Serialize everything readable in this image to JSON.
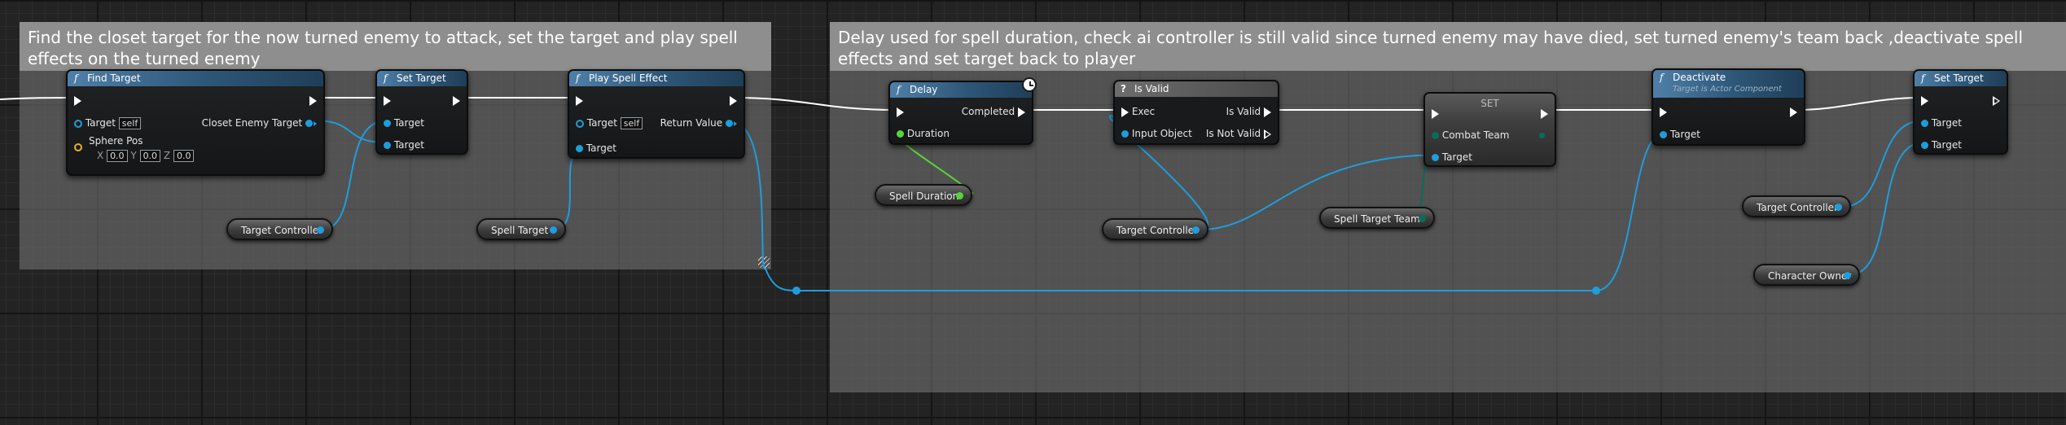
{
  "comments": [
    {
      "title": "Find the closet target for the now turned enemy to attack, set the target and play spell effects on the turned enemy"
    },
    {
      "title": "Delay used for spell duration, check ai controller is still valid since turned enemy may have died, set turned enemy's team back ,deactivate spell effects and set target back to player"
    }
  ],
  "find_target": {
    "title": "Find Target",
    "target_label": "Target",
    "target_value": "self",
    "output": "Closet Enemy Target",
    "sphere_label": "Sphere Pos",
    "x_label": "X",
    "x_value": "0.0",
    "y_label": "Y",
    "y_value": "0.0",
    "z_label": "Z",
    "z_value": "0.0"
  },
  "set_target_1": {
    "title": "Set Target",
    "pin1": "Target",
    "pin2": "Target"
  },
  "play_spell": {
    "title": "Play Spell Effect",
    "target_label": "Target",
    "target_value": "self",
    "return": "Return Value",
    "pin2": "Target"
  },
  "delay": {
    "title": "Delay",
    "completed": "Completed",
    "duration": "Duration"
  },
  "is_valid": {
    "title": "Is Valid",
    "exec": "Exec",
    "is_valid": "Is Valid",
    "input": "Input Object",
    "not_valid": "Is Not Valid"
  },
  "set_node": {
    "title": "SET",
    "combat_team": "Combat Team",
    "target": "Target"
  },
  "deactivate": {
    "title": "Deactivate",
    "subtitle": "Target is Actor Component",
    "target": "Target"
  },
  "set_target_2": {
    "title": "Set Target",
    "pin1": "Target",
    "pin2": "Target"
  },
  "variables": {
    "target_controller_1": "Target Controller",
    "spell_target": "Spell Target",
    "spell_duration": "Spell Duration",
    "target_controller_2": "Target Controller",
    "spell_target_team": "Spell Target Team",
    "target_controller_3": "Target Controller",
    "character_owner": "Character Owner"
  },
  "colors": {
    "object_pin": "#1e9ddc",
    "float_pin": "#57d43a",
    "exec_wire": "#ffffff",
    "byte_pin": "#0b6b5a",
    "vector_pin": "#e1b22c",
    "comment_header": "#8e8e8e",
    "function_header": "#2d5677"
  }
}
